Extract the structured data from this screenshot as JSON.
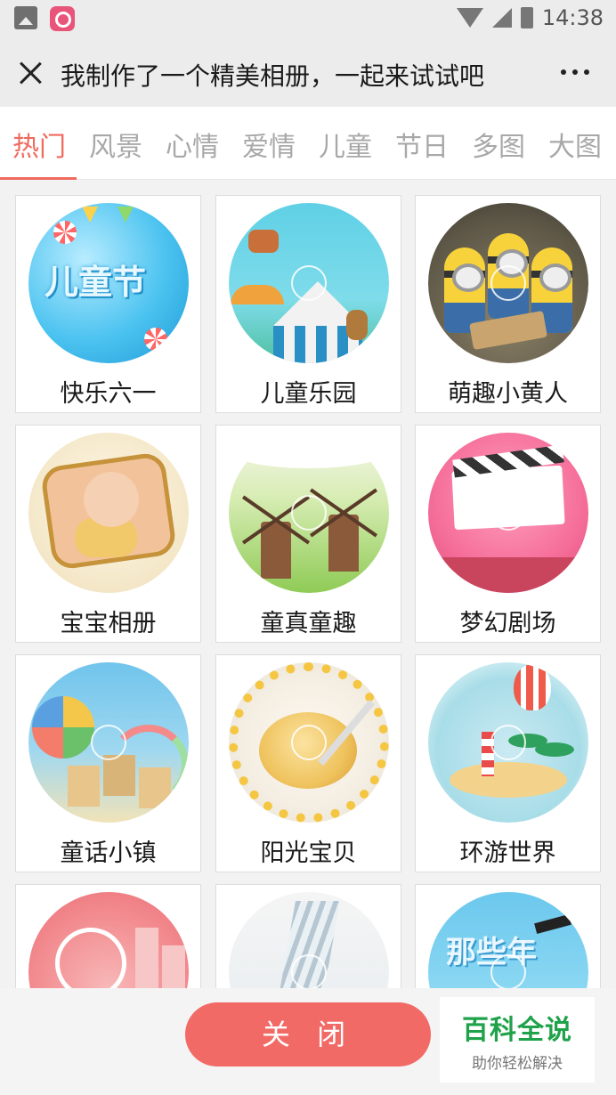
{
  "status_bar": {
    "time": "14:38"
  },
  "title_bar": {
    "title": "我制作了一个精美相册，一起来试试吧"
  },
  "tabs": [
    {
      "label": "热门",
      "active": true
    },
    {
      "label": "风景",
      "active": false
    },
    {
      "label": "心情",
      "active": false
    },
    {
      "label": "爱情",
      "active": false
    },
    {
      "label": "儿童",
      "active": false
    },
    {
      "label": "节日",
      "active": false
    },
    {
      "label": "多图",
      "active": false
    },
    {
      "label": "大图",
      "active": false
    }
  ],
  "albums": [
    {
      "label": "快乐六一",
      "thumb_text": "儿童节"
    },
    {
      "label": "儿童乐园"
    },
    {
      "label": "萌趣小黄人"
    },
    {
      "label": "宝宝相册"
    },
    {
      "label": "童真童趣"
    },
    {
      "label": "梦幻剧场"
    },
    {
      "label": "童话小镇"
    },
    {
      "label": "阳光宝贝"
    },
    {
      "label": "环游世界"
    },
    {
      "label": ""
    },
    {
      "label": ""
    },
    {
      "label": "",
      "thumb_text": "那些年"
    }
  ],
  "bottom_bar": {
    "close_label": "关 闭",
    "watermark_title": "百科全说",
    "watermark_sub": "助你轻松解决"
  },
  "colors": {
    "accent": "#f06a5e",
    "close_button": "#f26a66",
    "watermark_green": "#1fa24a",
    "tab_inactive": "#a8a8a8"
  }
}
